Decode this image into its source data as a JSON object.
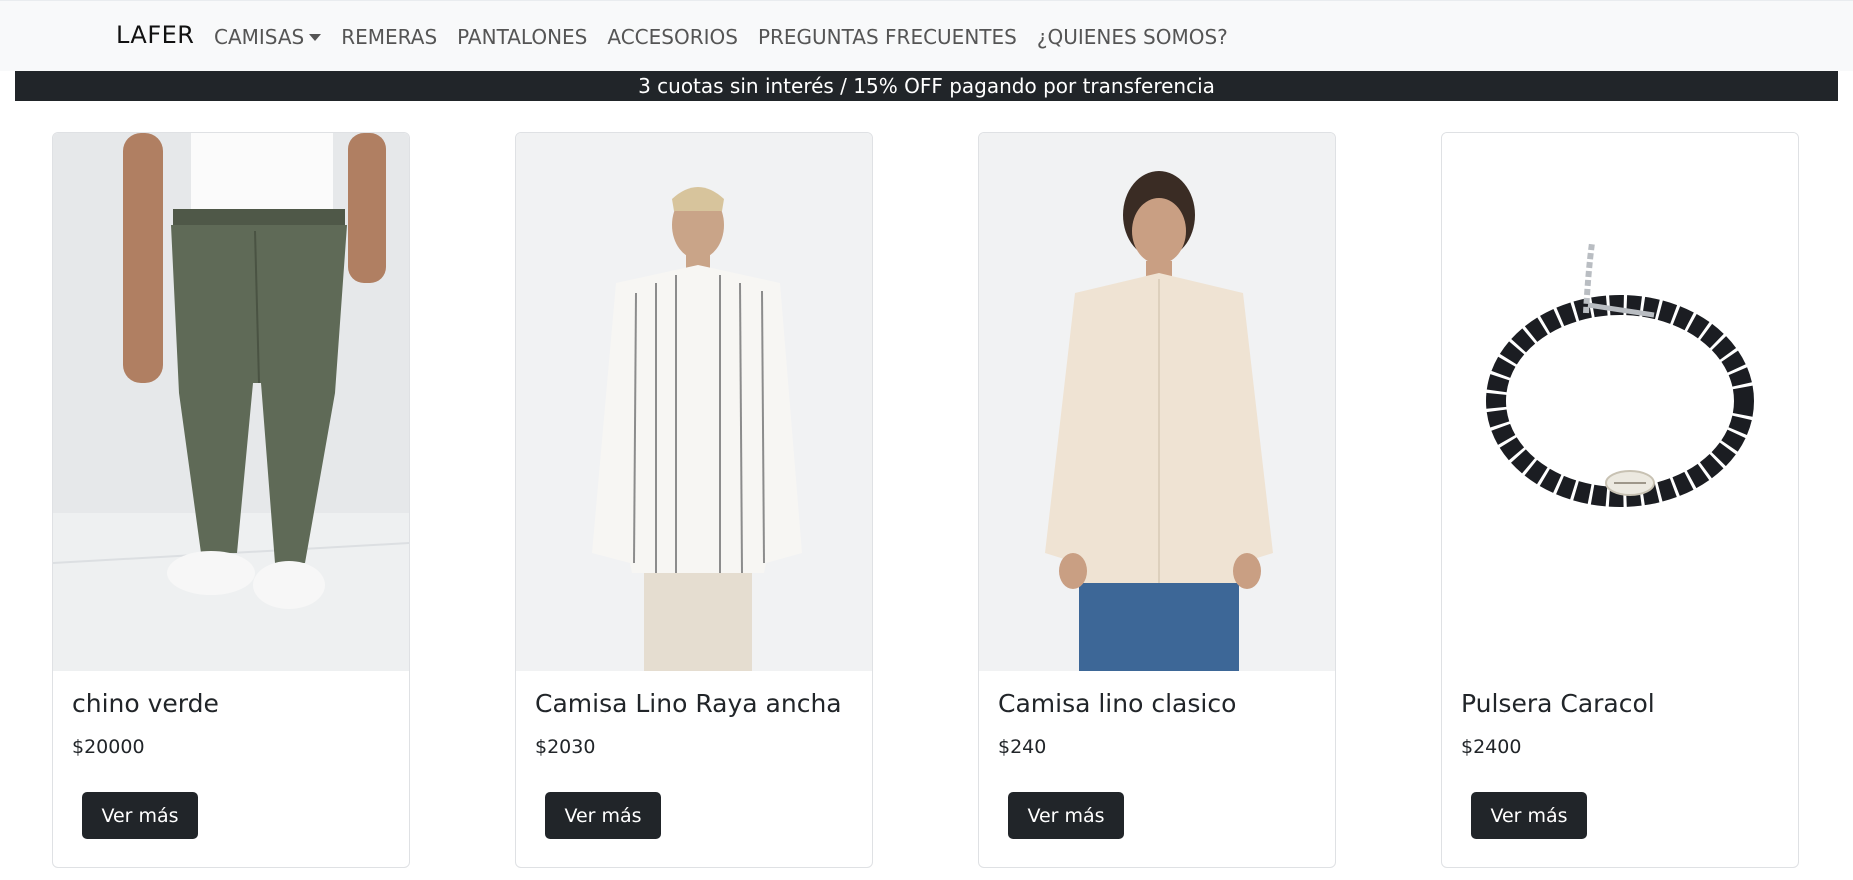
{
  "navbar": {
    "brand": "LAFER",
    "links": [
      "CAMISAS",
      "REMERAS",
      "PANTALONES",
      "ACCESORIOS",
      "PREGUNTAS FRECUENTES",
      "¿QUIENES SOMOS?"
    ]
  },
  "banner": {
    "text": "3 cuotas sin interés / 15% OFF pagando por transferencia"
  },
  "products": [
    {
      "title": "chino verde",
      "price": "$20000",
      "button": "Ver más",
      "image": "green-chino-pants-photo"
    },
    {
      "title": "Camisa Lino Raya ancha",
      "price": "$2030",
      "button": "Ver más",
      "image": "striped-linen-shirt-photo"
    },
    {
      "title": "Camisa lino clasico",
      "price": "$240",
      "button": "Ver más",
      "image": "beige-linen-shirt-photo"
    },
    {
      "title": "Pulsera Caracol",
      "price": "$2400",
      "button": "Ver más",
      "image": "shell-bracelet-photo"
    }
  ],
  "colors": {
    "dark": "#212529",
    "navbar_bg": "#f8f9fa",
    "pants_green": "#5f6a57",
    "shirt_beige": "#efe3d3"
  }
}
